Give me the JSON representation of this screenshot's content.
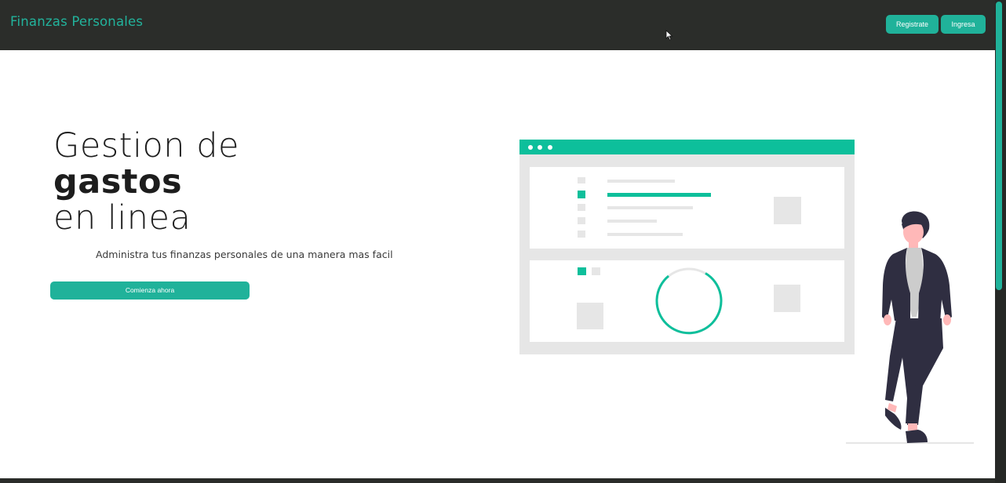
{
  "navbar": {
    "brand": "Finanzas Personales",
    "register_label": "Registrate",
    "login_label": "Ingresa"
  },
  "hero": {
    "title_line1": "Gestion de",
    "title_line2": "gastos",
    "title_line3": "en linea",
    "subtitle": "Administra tus finanzas personales de una manera mas facil",
    "cta_label": "Comienza ahora"
  },
  "illustration": {
    "name": "dashboard-with-person",
    "accent_color": "#0dbf9b",
    "panel_color": "#e6e6e6"
  },
  "colors": {
    "navbar_bg": "#2b2d2a",
    "brand_text": "#22b39c",
    "button_bg": "#20b29a",
    "page_bg": "#ffffff"
  },
  "icons": {
    "cursor": "mouse-pointer-icon"
  }
}
